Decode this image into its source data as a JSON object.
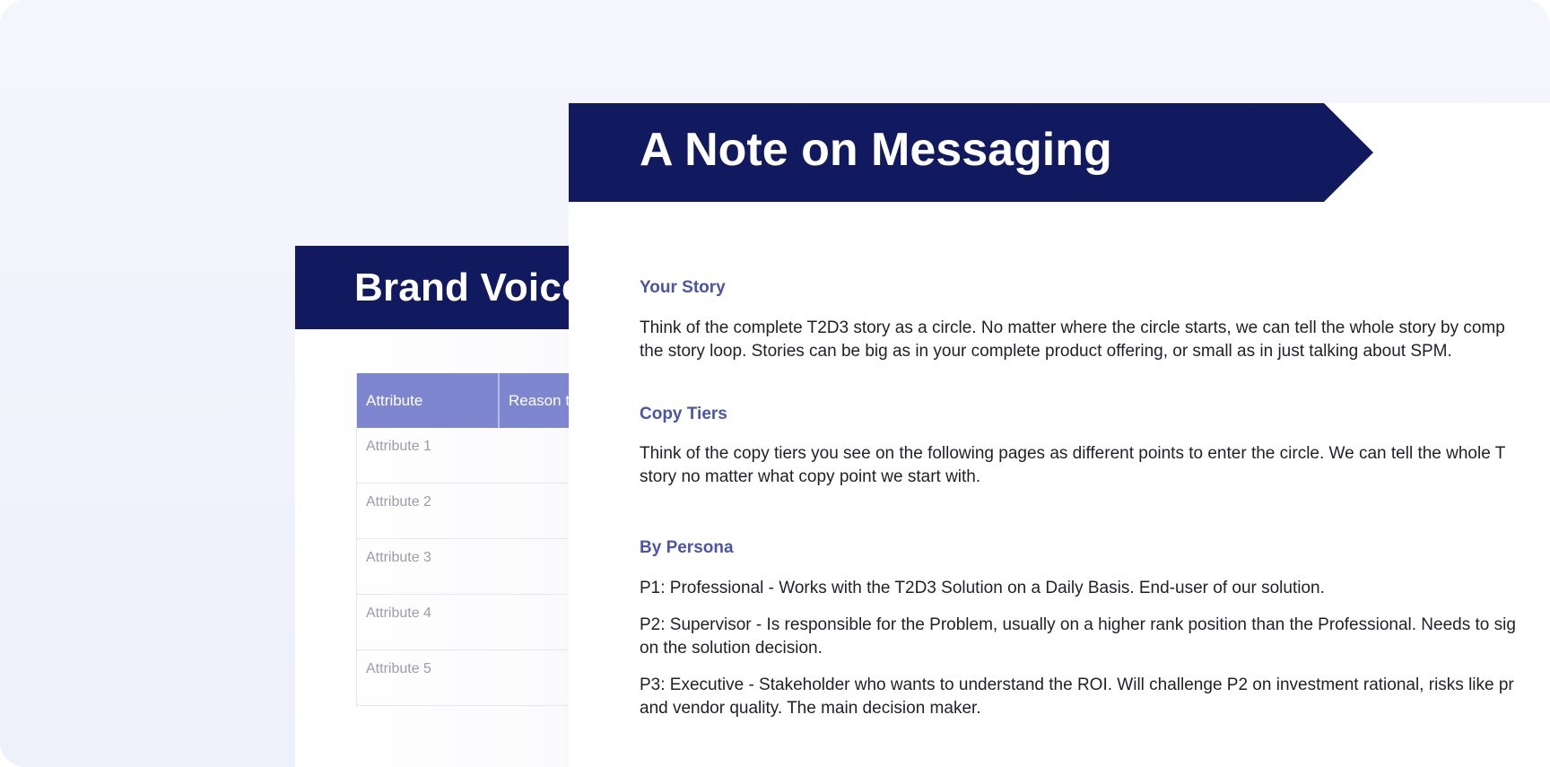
{
  "brand_voice": {
    "title": "Brand Voice",
    "table": {
      "headers": [
        "Attribute",
        "Reason t"
      ],
      "rows": [
        "Attribute 1",
        "Attribute 2",
        "Attribute 3",
        "Attribute 4",
        "Attribute 5"
      ]
    }
  },
  "messaging": {
    "title": "A Note on Messaging",
    "sections": [
      {
        "heading": "Your Story",
        "paragraphs": [
          "Think of the complete T2D3 story as a circle. No matter where the circle starts, we can tell the whole story by comp",
          "the story loop. Stories can be big as in your complete product offering, or small as in just talking about SPM."
        ]
      },
      {
        "heading": "Copy Tiers",
        "paragraphs": [
          "Think of the copy tiers you see on the following pages as different points to enter the circle. We can tell the whole T",
          "story no matter what copy point we start with."
        ]
      },
      {
        "heading": "By Persona",
        "paragraphs": [
          "P1: Professional - Works with the T2D3 Solution on a Daily Basis. End-user of our solution.",
          "P2: Supervisor - Is responsible for the Problem, usually on a higher rank position than the Professional. Needs to sig",
          "on the solution decision.",
          "P3: Executive - Stakeholder who wants to understand the ROI. Will challenge P2 on investment rational, risks like pr",
          "and vendor quality. The main decision maker."
        ]
      }
    ]
  },
  "colors": {
    "banner_navy": "#111a5e",
    "table_header": "#7d86cf",
    "section_heading": "#4a55a8",
    "background": "#f3f4fc"
  }
}
